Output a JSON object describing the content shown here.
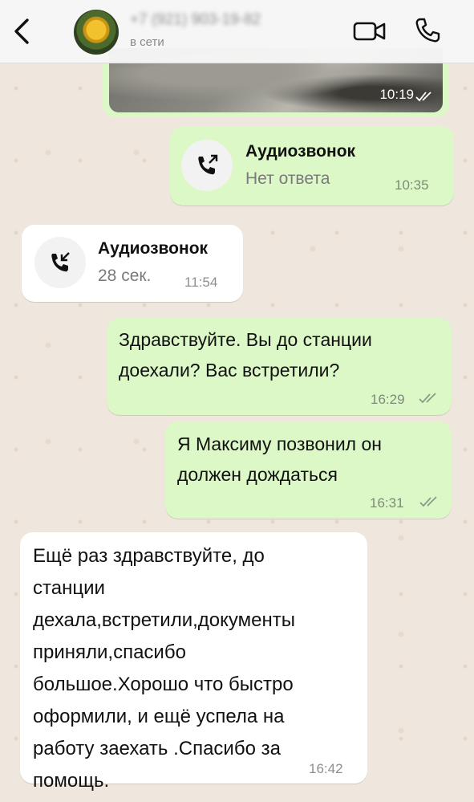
{
  "header": {
    "contact_name": "+7 (921) 903-19-82",
    "status": "в сети"
  },
  "photo_message": {
    "time": "10:19"
  },
  "calls": [
    {
      "title": "Аудиозвонок",
      "sub": "Нет ответа",
      "time": "10:35",
      "direction": "outgoing"
    },
    {
      "title": "Аудиозвонок",
      "sub": "28 сек.",
      "time": "11:54",
      "direction": "incoming"
    }
  ],
  "messages": [
    {
      "lines": [
        "Здравствуйте. Вы до станции",
        "доехали? Вас  встретили?"
      ],
      "time": "16:29",
      "direction": "outgoing"
    },
    {
      "lines": [
        "Я Максиму позвонил он",
        "должен дождаться"
      ],
      "time": "16:31",
      "direction": "outgoing"
    },
    {
      "lines": [
        "Ещё раз здравствуйте, до",
        "станции",
        "дехала,встретили,документы",
        "приняли,спасибо",
        "большое.Хорошо что быстро",
        "оформили, и  ещё успела на",
        "работу заехать .Спасибо за",
        "помощь."
      ],
      "time": "16:42",
      "direction": "incoming"
    }
  ],
  "colors": {
    "outgoing_bubble": "#dcf8c6",
    "incoming_bubble": "#ffffff",
    "read_ticks": "#8a9a8a",
    "wallpaper": "#efe7dd"
  },
  "icons": [
    "back-chevron-icon",
    "video-call-icon",
    "phone-icon",
    "outgoing-call-icon",
    "incoming-call-icon",
    "double-check-icon"
  ]
}
